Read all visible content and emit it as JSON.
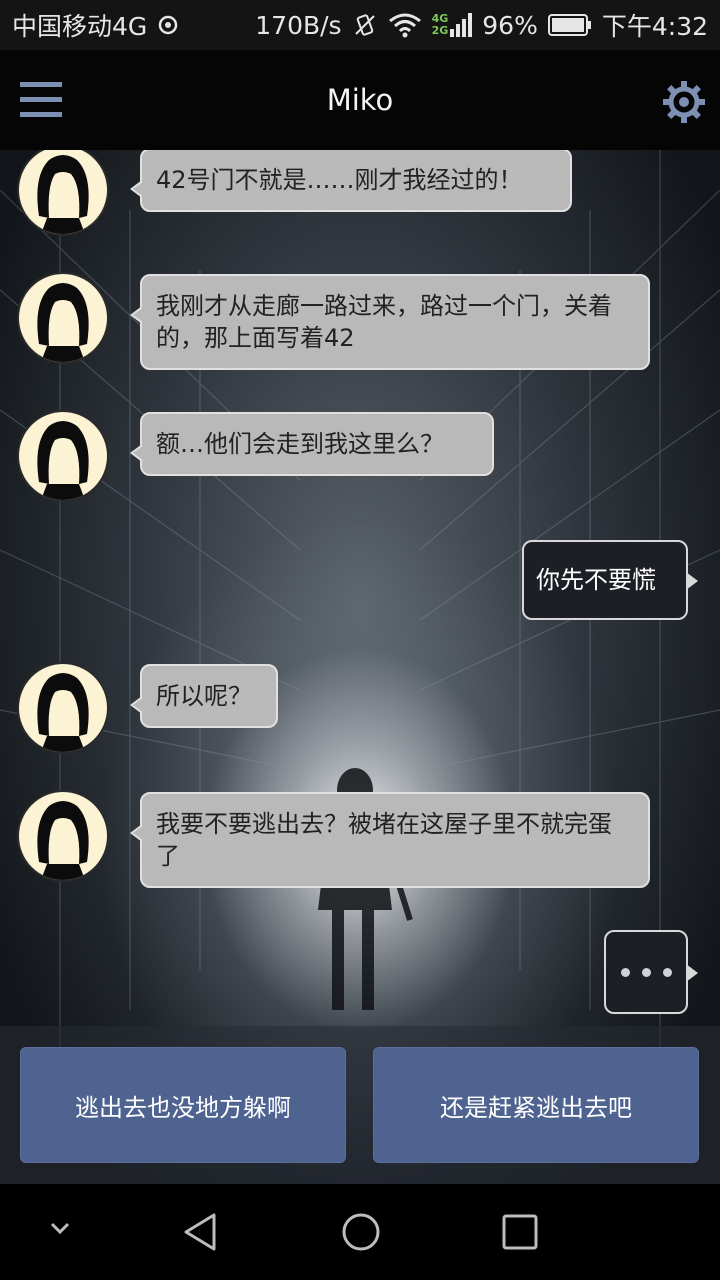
{
  "status_bar": {
    "carrier": "中国移动4G",
    "speed": "170B/s",
    "signal_tags": [
      "4G",
      "2G"
    ],
    "battery": "96%",
    "time": "下午4:32"
  },
  "header": {
    "title": "Miko",
    "menu_icon": "hamburger-menu-icon",
    "settings_icon": "gear-icon"
  },
  "messages": [
    {
      "side": "left",
      "text": "42号门不就是……刚才我经过的！"
    },
    {
      "side": "left",
      "text": "我刚才从走廊一路过来，路过一个门，关着的，那上面写着42"
    },
    {
      "side": "left",
      "text": "额…他们会走到我这里么？"
    },
    {
      "side": "right",
      "text": "你先不要慌"
    },
    {
      "side": "left",
      "text": "所以呢？"
    },
    {
      "side": "left",
      "text": "我要不要逃出去？被堵在这屋子里不就完蛋了"
    }
  ],
  "choices": [
    {
      "label": "逃出去也没地方躲啊"
    },
    {
      "label": "还是赶紧逃出去吧"
    }
  ],
  "colors": {
    "left_bubble": "#b9b9b9",
    "right_bubble": "#1c1f25",
    "choice_button": "#4f6390"
  }
}
